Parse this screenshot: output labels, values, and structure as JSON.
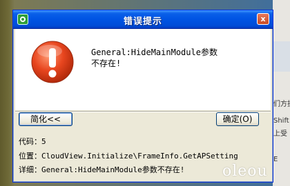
{
  "background": {
    "side_texts": [
      "们方抗",
      "Shift",
      "上受",
      "E"
    ]
  },
  "dialog": {
    "title": "错误提示",
    "close_glyph": "x",
    "message": "General:HideMainModule参数不存在!",
    "details_button": "简化<<",
    "ok_button": "确定(O)",
    "details": {
      "code": "代码：5",
      "location": "位置：CloudView.Initialize\\FrameInfo.GetAPSetting",
      "info": "详细：General:HideMainModule参数不存在!"
    }
  },
  "watermark": "oleou",
  "colors": {
    "title_bar": "#0054e3",
    "dialog_bg": "#ece9d8",
    "error_red": "#e03a1f"
  }
}
